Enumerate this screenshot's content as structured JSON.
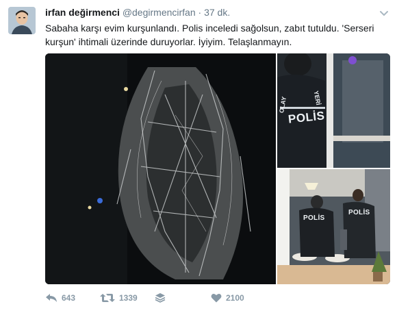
{
  "tweet": {
    "author_name": "irfan değirmenci",
    "handle": "@degirmencirfan",
    "separator": "·",
    "time": "37 dk.",
    "text": "Sabaha karşı evim kurşunlandı. Polis inceledi sağolsun, zabıt tutuldu. 'Serseri kurşun' ihtimali üzerinde duruyorlar. İyiyim. Telaşlanmayın."
  },
  "media": {
    "photo2_vest_text_1": "POLİS",
    "photo2_vest_text_2": "OLAY",
    "photo2_vest_text_3": "YERİ",
    "photo3_vest_text_1": "POLİS",
    "photo3_vest_text_2": "POLİS"
  },
  "actions": {
    "reply_count": "643",
    "retweet_count": "1339",
    "like_count": "2100"
  },
  "icons": {
    "reply": "reply-icon",
    "retweet": "retweet-icon",
    "stack": "stack-icon",
    "like": "heart-icon",
    "more": "chevron-down-icon"
  },
  "colors": {
    "name": "#14171a",
    "meta": "#657786",
    "action": "#8899a6"
  }
}
